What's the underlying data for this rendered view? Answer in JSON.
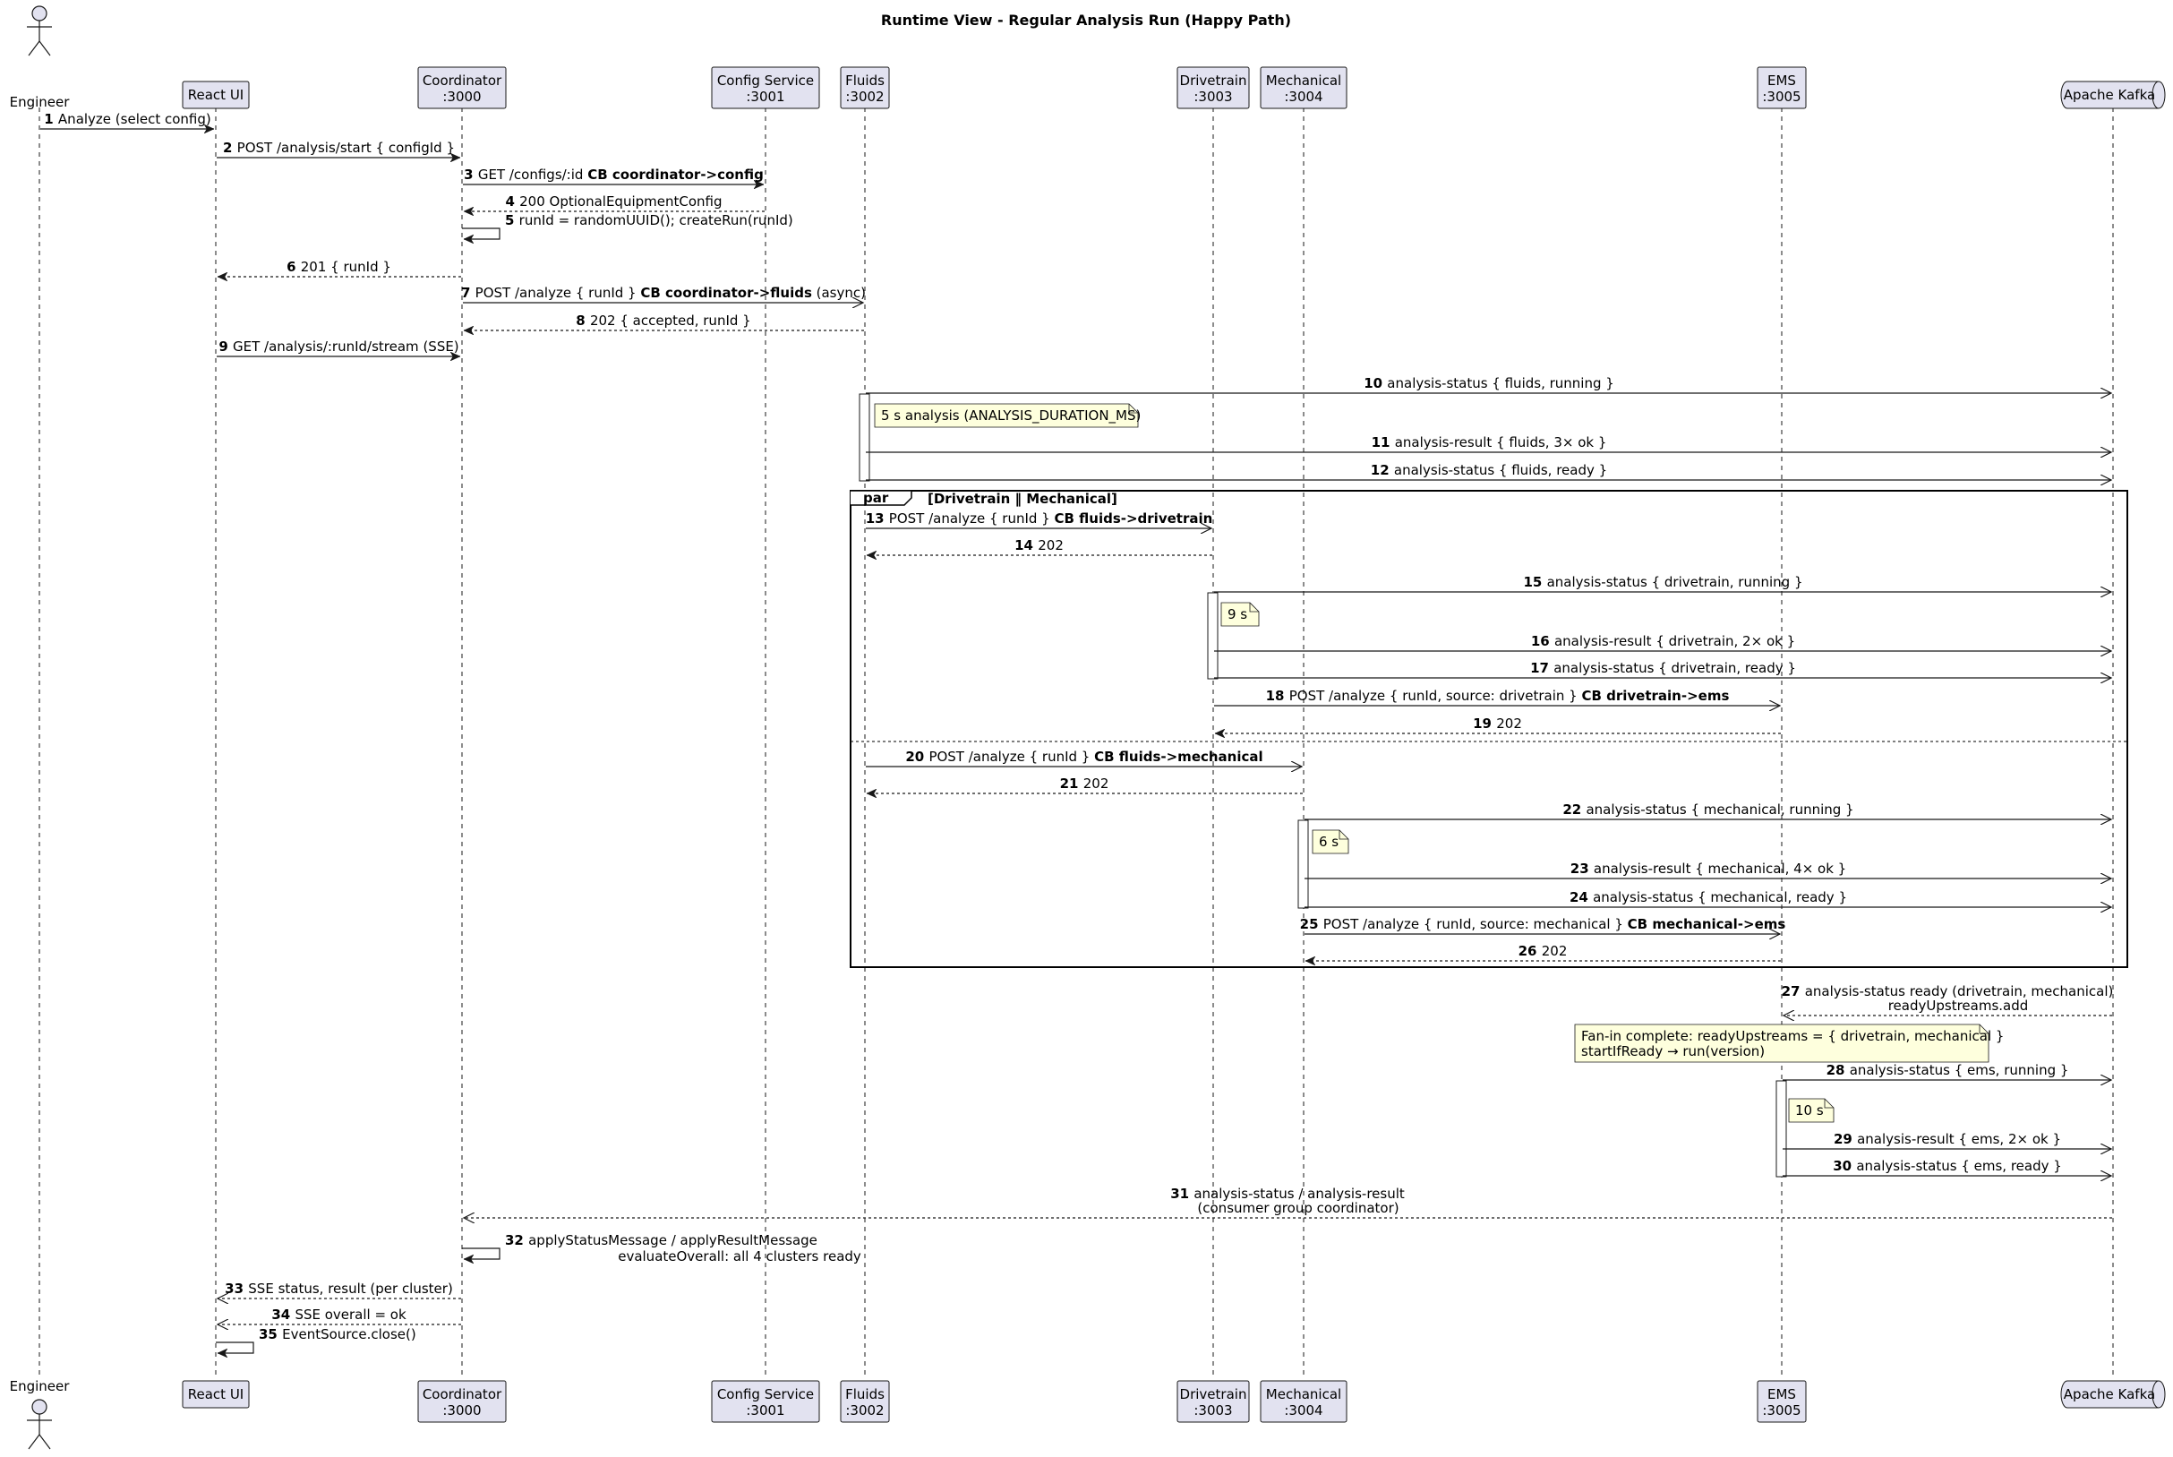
{
  "title": "Runtime View - Regular Analysis Run (Happy Path)",
  "participants": [
    {
      "id": "eng",
      "label": [
        "Engineer"
      ],
      "kind": "actor"
    },
    {
      "id": "ui",
      "label": [
        "React UI"
      ],
      "kind": "box"
    },
    {
      "id": "coord",
      "label": [
        "Coordinator",
        ":3000"
      ],
      "kind": "box"
    },
    {
      "id": "cfg",
      "label": [
        "Config Service",
        ":3001"
      ],
      "kind": "box"
    },
    {
      "id": "flu",
      "label": [
        "Fluids",
        ":3002"
      ],
      "kind": "box"
    },
    {
      "id": "drv",
      "label": [
        "Drivetrain",
        ":3003"
      ],
      "kind": "box"
    },
    {
      "id": "mec",
      "label": [
        "Mechanical",
        ":3004"
      ],
      "kind": "box"
    },
    {
      "id": "ems",
      "label": [
        "EMS",
        ":3005"
      ],
      "kind": "box"
    },
    {
      "id": "kaf",
      "label": [
        "Apache Kafka"
      ],
      "kind": "queue"
    }
  ],
  "messages": [
    {
      "n": "1",
      "from": "eng",
      "to": "ui",
      "style": "sync",
      "parts": [
        {
          "t": "Analyze (select config)"
        }
      ]
    },
    {
      "n": "2",
      "from": "ui",
      "to": "coord",
      "style": "sync",
      "parts": [
        {
          "t": "POST /analysis/start { configId }"
        }
      ]
    },
    {
      "n": "3",
      "from": "coord",
      "to": "cfg",
      "style": "sync",
      "parts": [
        {
          "t": "GET /configs/:id  "
        },
        {
          "t": "CB coordinator->config",
          "b": true
        }
      ]
    },
    {
      "n": "4",
      "from": "cfg",
      "to": "coord",
      "style": "reply",
      "parts": [
        {
          "t": "200 OptionalEquipmentConfig"
        }
      ]
    },
    {
      "n": "5",
      "from": "coord",
      "to": "coord",
      "style": "self",
      "parts": [
        {
          "t": "runId = randomUUID(); createRun(runId)"
        }
      ]
    },
    {
      "n": "6",
      "from": "coord",
      "to": "ui",
      "style": "reply",
      "parts": [
        {
          "t": "201 { runId }"
        }
      ]
    },
    {
      "n": "7",
      "from": "coord",
      "to": "flu",
      "style": "async",
      "parts": [
        {
          "t": "POST /analyze { runId }  "
        },
        {
          "t": "CB coordinator->fluids",
          "b": true
        },
        {
          "t": " (async)"
        }
      ]
    },
    {
      "n": "8",
      "from": "flu",
      "to": "coord",
      "style": "reply",
      "parts": [
        {
          "t": "202 { accepted, runId }"
        }
      ]
    },
    {
      "n": "9",
      "from": "ui",
      "to": "coord",
      "style": "sync",
      "parts": [
        {
          "t": "GET /analysis/:runId/stream (SSE)"
        }
      ]
    },
    {
      "n": "10",
      "from": "flu",
      "to": "kaf",
      "style": "async",
      "parts": [
        {
          "t": "analysis-status { fluids, running }"
        }
      ]
    },
    {
      "n": "11",
      "from": "flu",
      "to": "kaf",
      "style": "async",
      "parts": [
        {
          "t": "analysis-result { fluids, 3× ok }"
        }
      ]
    },
    {
      "n": "12",
      "from": "flu",
      "to": "kaf",
      "style": "async",
      "parts": [
        {
          "t": "analysis-status { fluids, ready }"
        }
      ]
    },
    {
      "n": "13",
      "from": "flu",
      "to": "drv",
      "style": "async",
      "parts": [
        {
          "t": "POST /analyze { runId }  "
        },
        {
          "t": "CB fluids->drivetrain",
          "b": true
        }
      ]
    },
    {
      "n": "14",
      "from": "drv",
      "to": "flu",
      "style": "reply",
      "parts": [
        {
          "t": "202"
        }
      ]
    },
    {
      "n": "15",
      "from": "drv",
      "to": "kaf",
      "style": "async",
      "parts": [
        {
          "t": "analysis-status { drivetrain, running }"
        }
      ]
    },
    {
      "n": "16",
      "from": "drv",
      "to": "kaf",
      "style": "async",
      "parts": [
        {
          "t": "analysis-result { drivetrain, 2× ok }"
        }
      ]
    },
    {
      "n": "17",
      "from": "drv",
      "to": "kaf",
      "style": "async",
      "parts": [
        {
          "t": "analysis-status { drivetrain, ready }"
        }
      ]
    },
    {
      "n": "18",
      "from": "drv",
      "to": "ems",
      "style": "async",
      "parts": [
        {
          "t": "POST /analyze { runId, source: drivetrain }  "
        },
        {
          "t": "CB drivetrain->ems",
          "b": true
        }
      ]
    },
    {
      "n": "19",
      "from": "ems",
      "to": "drv",
      "style": "reply",
      "parts": [
        {
          "t": "202"
        }
      ]
    },
    {
      "n": "20",
      "from": "flu",
      "to": "mec",
      "style": "async",
      "parts": [
        {
          "t": "POST /analyze { runId }  "
        },
        {
          "t": "CB fluids->mechanical",
          "b": true
        }
      ]
    },
    {
      "n": "21",
      "from": "mec",
      "to": "flu",
      "style": "reply",
      "parts": [
        {
          "t": "202"
        }
      ]
    },
    {
      "n": "22",
      "from": "mec",
      "to": "kaf",
      "style": "async",
      "parts": [
        {
          "t": "analysis-status { mechanical, running }"
        }
      ]
    },
    {
      "n": "23",
      "from": "mec",
      "to": "kaf",
      "style": "async",
      "parts": [
        {
          "t": "analysis-result { mechanical, 4× ok }"
        }
      ]
    },
    {
      "n": "24",
      "from": "mec",
      "to": "kaf",
      "style": "async",
      "parts": [
        {
          "t": "analysis-status { mechanical, ready }"
        }
      ]
    },
    {
      "n": "25",
      "from": "mec",
      "to": "ems",
      "style": "async",
      "parts": [
        {
          "t": "POST /analyze { runId, source: mechanical }  "
        },
        {
          "t": "CB mechanical->ems",
          "b": true
        }
      ]
    },
    {
      "n": "26",
      "from": "ems",
      "to": "mec",
      "style": "reply",
      "parts": [
        {
          "t": "202"
        }
      ]
    },
    {
      "n": "27",
      "from": "kaf",
      "to": "ems",
      "style": "asyncreply",
      "lines": [
        "analysis-status ready (drivetrain, mechanical)",
        "readyUpstreams.add"
      ]
    },
    {
      "n": "28",
      "from": "ems",
      "to": "kaf",
      "style": "async",
      "parts": [
        {
          "t": "analysis-status { ems, running }"
        }
      ]
    },
    {
      "n": "29",
      "from": "ems",
      "to": "kaf",
      "style": "async",
      "parts": [
        {
          "t": "analysis-result { ems, 2× ok }"
        }
      ]
    },
    {
      "n": "30",
      "from": "ems",
      "to": "kaf",
      "style": "async",
      "parts": [
        {
          "t": "analysis-status { ems, ready }"
        }
      ]
    },
    {
      "n": "31",
      "from": "kaf",
      "to": "coord",
      "style": "asyncreply",
      "lines": [
        "analysis-status / analysis-result",
        "(consumer group coordinator)"
      ]
    },
    {
      "n": "32",
      "from": "coord",
      "to": "coord",
      "style": "self",
      "lines": [
        "applyStatusMessage / applyResultMessage",
        "evaluateOverall: all 4 clusters ready"
      ]
    },
    {
      "n": "33",
      "from": "coord",
      "to": "ui",
      "style": "asyncreply",
      "parts": [
        {
          "t": "SSE status, result (per cluster)"
        }
      ]
    },
    {
      "n": "34",
      "from": "coord",
      "to": "ui",
      "style": "asyncreply",
      "parts": [
        {
          "t": "SSE overall = ok"
        }
      ]
    },
    {
      "n": "35",
      "from": "ui",
      "to": "ui",
      "style": "self",
      "parts": [
        {
          "t": "EventSource.close()"
        }
      ]
    }
  ],
  "notes": [
    {
      "id": "note-fluids",
      "lines": [
        "5 s analysis (ANALYSIS_DURATION_MS)"
      ]
    },
    {
      "id": "note-drivetrain",
      "lines": [
        "9 s"
      ]
    },
    {
      "id": "note-mechanical",
      "lines": [
        "6 s"
      ]
    },
    {
      "id": "note-fanin",
      "lines": [
        "Fan-in complete: readyUpstreams = { drivetrain, mechanical }",
        "startIfReady → run(version)"
      ]
    },
    {
      "id": "note-ems",
      "lines": [
        "10 s"
      ]
    }
  ],
  "par_frame": {
    "keyword": "par",
    "condition": "[Drivetrain ‖ Mechanical]"
  }
}
